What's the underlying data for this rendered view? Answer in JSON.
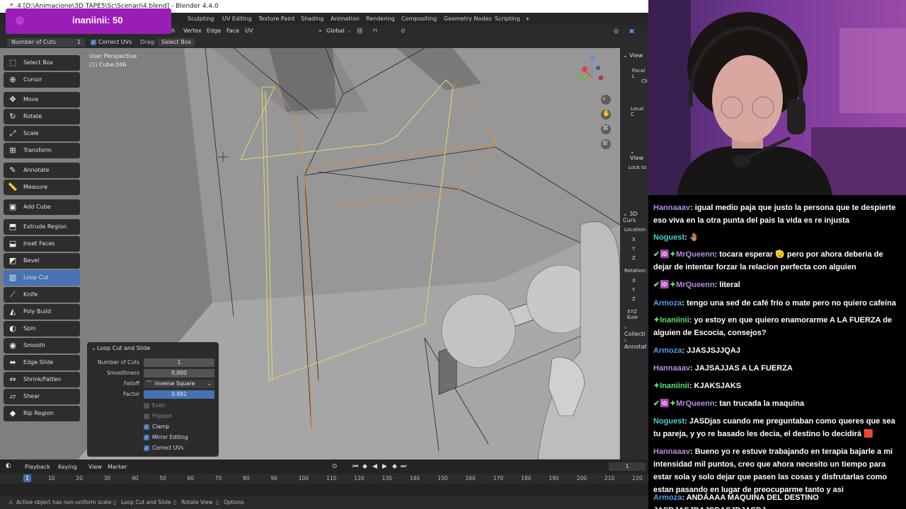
{
  "window": {
    "title": "* .4 [D:\\Animacione\\3D TAPE5\\Sc\\Scenari\\4.blend] - Blender 4.4.0"
  },
  "viewer_badge": {
    "text": "inaniinii: 50"
  },
  "workspace_tabs": [
    "Sculpting",
    "UV Editing",
    "Texture Paint",
    "Shading",
    "Animation",
    "Rendering",
    "Compositing",
    "Geometry Nodes",
    "Scripting",
    "+"
  ],
  "header": {
    "menu_items": [
      "sh",
      "Vertex",
      "Edge",
      "Face",
      "UV"
    ],
    "orientation": "Global"
  },
  "tool_settings": {
    "number_of_cuts_label": "Number of Cuts",
    "number_of_cuts_value": "1",
    "correct_uvs_label": "Correct UVs",
    "drag_label": "Drag:",
    "drag_value": "Select Box"
  },
  "viewport": {
    "perspective": "User Perspective",
    "object": "(1) Cube.046"
  },
  "toolbar": [
    {
      "label": "Select Box",
      "icon": "select-box-icon",
      "glyph": "⬚",
      "group": 0
    },
    {
      "label": "Cursor",
      "icon": "cursor-icon",
      "glyph": "⊕",
      "group": 0
    },
    {
      "label": "Move",
      "icon": "move-icon",
      "glyph": "✥",
      "group": 1
    },
    {
      "label": "Rotate",
      "icon": "rotate-icon",
      "glyph": "↻",
      "group": 1
    },
    {
      "label": "Scale",
      "icon": "scale-icon",
      "glyph": "⤢",
      "group": 1
    },
    {
      "label": "Transform",
      "icon": "transform-icon",
      "glyph": "⊞",
      "group": 1
    },
    {
      "label": "Annotate",
      "icon": "annotate-icon",
      "glyph": "✎",
      "group": 2
    },
    {
      "label": "Measure",
      "icon": "measure-icon",
      "glyph": "📏",
      "group": 2
    },
    {
      "label": "Add Cube",
      "icon": "add-cube-icon",
      "glyph": "▣",
      "group": 3
    },
    {
      "label": "Extrude Region",
      "icon": "extrude-region-icon",
      "glyph": "⬒",
      "group": 4
    },
    {
      "label": "Inset Faces",
      "icon": "inset-faces-icon",
      "glyph": "⬓",
      "group": 4
    },
    {
      "label": "Bevel",
      "icon": "bevel-icon",
      "glyph": "◩",
      "group": 4
    },
    {
      "label": "Loop Cut",
      "icon": "loop-cut-icon",
      "glyph": "▥",
      "group": 4,
      "active": true
    },
    {
      "label": "Knife",
      "icon": "knife-icon",
      "glyph": "⟋",
      "group": 4
    },
    {
      "label": "Poly Build",
      "icon": "poly-build-icon",
      "glyph": "◭",
      "group": 4
    },
    {
      "label": "Spin",
      "icon": "spin-icon",
      "glyph": "◐",
      "group": 4
    },
    {
      "label": "Smooth",
      "icon": "smooth-icon",
      "glyph": "◉",
      "group": 4
    },
    {
      "label": "Edge Slide",
      "icon": "edge-slide-icon",
      "glyph": "⬌",
      "group": 4
    },
    {
      "label": "Shrink/Fatten",
      "icon": "shrink-fatten-icon",
      "glyph": "⇔",
      "group": 4
    },
    {
      "label": "Shear",
      "icon": "shear-icon",
      "glyph": "▱",
      "group": 4
    },
    {
      "label": "Rip Region",
      "icon": "rip-region-icon",
      "glyph": "◆",
      "group": 4
    }
  ],
  "redo_panel": {
    "title": "Loop Cut and Slide",
    "number_of_cuts_label": "Number of Cuts",
    "number_of_cuts": "1",
    "smoothness_label": "Smoothness",
    "smoothness": "0.000",
    "falloff_label": "Falloff",
    "falloff": "Inverse Square",
    "factor_label": "Factor",
    "factor": "0.892",
    "even_label": "Even",
    "flipped_label": "Flipped",
    "clamp_label": "Clamp",
    "mirror_label": "Mirror Editing",
    "correct_uvs_label": "Correct UVs"
  },
  "npanel": {
    "view_header": "View",
    "focal": "Focal L",
    "clip": "Cli",
    "local_c": "Local C",
    "view2": "View",
    "lock": "Lock to",
    "cursor_header": "3D Curs",
    "location": "Location:",
    "x": "X",
    "y": "Y",
    "z": "Z",
    "rotation": "Rotation:",
    "xyz": "XYZ Eule",
    "collections": "Collecti",
    "annotations": "Annotat"
  },
  "timeline": {
    "menus": [
      "Playback",
      "Keying",
      "View",
      "Marker"
    ],
    "current_frame": "1",
    "frame_marker": "1",
    "ticks": [
      "10",
      "20",
      "30",
      "40",
      "50",
      "60",
      "70",
      "80",
      "90",
      "100",
      "110",
      "120",
      "130",
      "140",
      "150",
      "160",
      "170",
      "180",
      "190",
      "200",
      "210",
      "220"
    ]
  },
  "status": {
    "warning": "Active object has non-uniform scale",
    "op": "Loop Cut and Slide",
    "rotate": "Rotate View",
    "options": "Options"
  },
  "chat": [
    {
      "user": "Hannaaav",
      "color": "#b48ee0",
      "badges": "",
      "text": "igual medio paja que justo la persona que te despierte eso viva en la otra punta del pais la vida es re injusta"
    },
    {
      "user": "Noguest",
      "color": "#3fd1d1",
      "badges": "",
      "text": "🤚🏽"
    },
    {
      "user": "MrQueenn",
      "color": "#b48ee0",
      "badges": "✔🆔✦",
      "text": "tocara esperar 🫡 pero por ahora deberia de dejar de intentar forzar la relacion perfecta con alguien"
    },
    {
      "user": "MrQueenn",
      "color": "#b48ee0",
      "badges": "✔🆔✦",
      "text": "literal"
    },
    {
      "user": "Armoza",
      "color": "#5b9bf0",
      "badges": "",
      "text": "tengo una sed de café frío o mate pero no quiero cafeína"
    },
    {
      "user": "Inaniinii",
      "color": "#5fe07a",
      "badges": "✦",
      "text": "yo estoy en que quiero enamorarme A LA FUERZA de alguien de Escocia, consejos?"
    },
    {
      "user": "Armoza",
      "color": "#5b9bf0",
      "badges": "",
      "text": "JJASJSJJQAJ"
    },
    {
      "user": "Hannaaav",
      "color": "#b48ee0",
      "badges": "",
      "text": "JAJSAJJAS A LA FUERZA"
    },
    {
      "user": "Inaniinii",
      "color": "#5fe07a",
      "badges": "✦",
      "text": "KJAKSJAKS"
    },
    {
      "user": "MrQueenn",
      "color": "#b48ee0",
      "badges": "✔🆔✦",
      "text": "tan trucada la maquina"
    },
    {
      "user": "Noguest",
      "color": "#3fd1d1",
      "badges": "",
      "text": "JASDjas cuando me preguntaban como queres que sea tu pareja, y yo re basado les decia, el destino lo decidirá 🟥"
    },
    {
      "user": "Hannaaav",
      "color": "#b48ee0",
      "badges": "",
      "text": "Bueno yo re estuve trabajando en terapia bajarle a mi intensidad mil puntos, creo que ahora necesito un tiempo para estar sola y solo dejar que pasen las cosas y disfrutarlas como estan pasando en lugar de preocuparme tanto y asi"
    },
    {
      "user": "Armoza",
      "color": "#5b9bf0",
      "badges": "",
      "text": "ANDÁAAA MAQUINA DEL DESTINO JASDJASJDAJSDASJDJASDJ"
    }
  ]
}
